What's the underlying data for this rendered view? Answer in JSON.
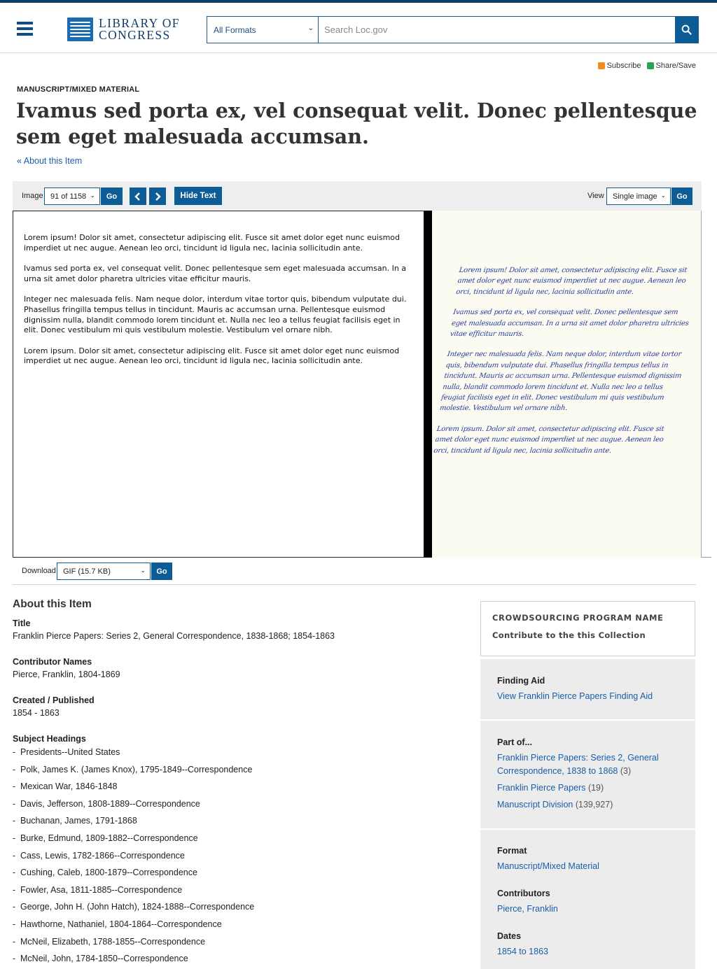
{
  "header": {
    "logo_line1": "LIBRARY OF",
    "logo_line2": "CONGRESS",
    "format_select": "All Formats",
    "search_placeholder": "Search Loc.gov"
  },
  "share": {
    "subscribe": "Subscribe",
    "share_save": "Share/Save"
  },
  "item": {
    "kind": "MANUSCRIPT/MIXED MATERIAL",
    "title": "Ivamus sed porta ex, vel consequat velit. Donec pellentesque sem eget malesuada accumsan.",
    "about_link": "« About this Item"
  },
  "viewer": {
    "image_label": "Image",
    "image_select": "91 of 1158",
    "go_label": "Go",
    "hide_text_label": "Hide Text",
    "view_label": "View",
    "view_select": "Single image",
    "transcript": [
      "Lorem ipsum! Dolor sit amet, consectetur adipiscing elit. Fusce sit amet dolor eget nunc euismod imperdiet ut nec augue. Aenean leo orci, tincidunt id ligula nec, lacinia sollicitudin ante.",
      "Ivamus sed porta ex, vel consequat velit. Donec pellentesque sem eget malesuada accumsan. In a urna sit amet dolor pharetra ultricies vitae efficitur mauris.",
      "Integer nec malesuada felis. Nam neque dolor, interdum vitae tortor quis, bibendum vulputate dui. Phasellus fringilla tempus tellus in tincidunt. Mauris ac accumsan urna. Pellentesque euismod dignissim nulla, blandit commodo lorem tincidunt et. Nulla nec leo a tellus feugiat facilisis eget in elit. Donec vestibulum mi quis vestibulum molestie. Vestibulum vel ornare nibh.",
      "Lorem ipsum. Dolor sit amet, consectetur adipiscing elit. Fusce sit amet dolor eget nunc euismod imperdiet ut nec augue. Aenean leo orci, tincidunt id ligula nec, lacinia sollicitudin ante."
    ]
  },
  "download": {
    "label": "Download",
    "select": "GIF (15.7 KB)",
    "go_label": "Go"
  },
  "about": {
    "heading": "About this Item",
    "title_label": "Title",
    "title_value": "Franklin Pierce Papers: Series 2, General Correspondence, 1838-1868; 1854-1863",
    "contributor_label": "Contributor Names",
    "contributor_value": "Pierce, Franklin, 1804-1869",
    "created_label": "Created / Published",
    "created_value": "1854 - 1863",
    "subjects_label": "Subject Headings",
    "subjects": [
      "Presidents--United States",
      "Polk, James K. (James Knox), 1795-1849--Correspondence",
      "Mexican War, 1846-1848",
      "Davis, Jefferson, 1808-1889--Correspondence",
      "Buchanan, James, 1791-1868",
      "Burke, Edmund, 1809-1882--Correspondence",
      "Cass, Lewis, 1782-1866--Correspondence",
      "Cushing, Caleb, 1800-1879--Correspondence",
      "Fowler, Asa, 1811-1885--Correspondence",
      "George, John H. (John Hatch), 1824-1888--Correspondence",
      "Hawthorne, Nathaniel, 1804-1864--Correspondence",
      "McNeil, Elizabeth, 1788-1855--Correspondence",
      "McNeil, John, 1784-1850--Correspondence"
    ]
  },
  "sidebar": {
    "crowd_heading": "CROWDSOURCING PROGRAM NAME",
    "crowd_link": "Contribute to the this Collection",
    "finding_aid_label": "Finding Aid",
    "finding_aid_link": "View Franklin Pierce Papers Finding Aid",
    "part_of_label": "Part of...",
    "part_of": [
      {
        "line1": "Franklin Pierce Papers: Series 2, General",
        "line2": "Correspondence, 1838 to 1868",
        "count": "(3)"
      },
      {
        "line1": "Franklin Pierce Papers",
        "count": "(19)"
      },
      {
        "line1": "Manuscript Division",
        "count": "(139,927)"
      }
    ],
    "format_label": "Format",
    "format_link": "Manuscript/Mixed Material",
    "contributors_label": "Contributors",
    "contributors_link": "Pierce, Franklin",
    "dates_label": "Dates",
    "dates_link": "1854 to 1863"
  }
}
